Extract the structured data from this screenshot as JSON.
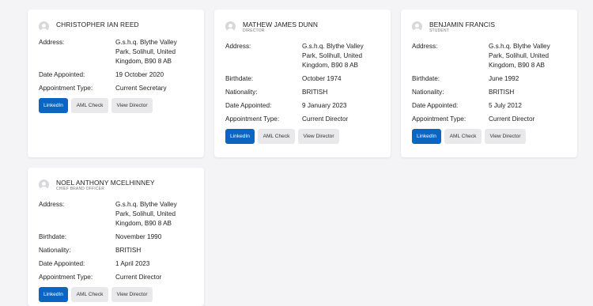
{
  "labels": {
    "address": "Address:",
    "birthdate": "Birthdate:",
    "nationality": "Nationality:",
    "date_appointed": "Date Appointed:",
    "appointment_type": "Appointment Type:"
  },
  "buttons": {
    "linkedin": "LinkedIn",
    "aml": "AML Check",
    "view": "View Director"
  },
  "directors": [
    {
      "name": "CHRISTOPHER IAN REED",
      "role": "",
      "address": "G.s.h.q. Blythe Valley Park, Solihull, United Kingdom, B90 8 AB",
      "date_appointed": "19 October 2020",
      "appointment_type": "Current Secretary"
    },
    {
      "name": "MATHEW JAMES DUNN",
      "role": "DIRECTOR",
      "address": "G.s.h.q. Blythe Valley Park, Solihull, United Kingdom, B90 8 AB",
      "birthdate": "October 1974",
      "nationality": "BRITISH",
      "date_appointed": "9 January 2023",
      "appointment_type": "Current Director"
    },
    {
      "name": "BENJAMIN FRANCIS",
      "role": "STUDENT",
      "address": "G.s.h.q. Blythe Valley Park, Solihull, United Kingdom, B90 8 AB",
      "birthdate": "June 1992",
      "nationality": "BRITISH",
      "date_appointed": "5 July 2012",
      "appointment_type": "Current Director"
    },
    {
      "name": "NOEL ANTHONY MCELHINNEY",
      "role": "CHIEF BRAND OFFICER",
      "address": "G.s.h.q. Blythe Valley Park, Solihull, United Kingdom, B90 8 AB",
      "birthdate": "November 1990",
      "nationality": "BRITISH",
      "date_appointed": "1 April 2023",
      "appointment_type": "Current Director"
    }
  ]
}
